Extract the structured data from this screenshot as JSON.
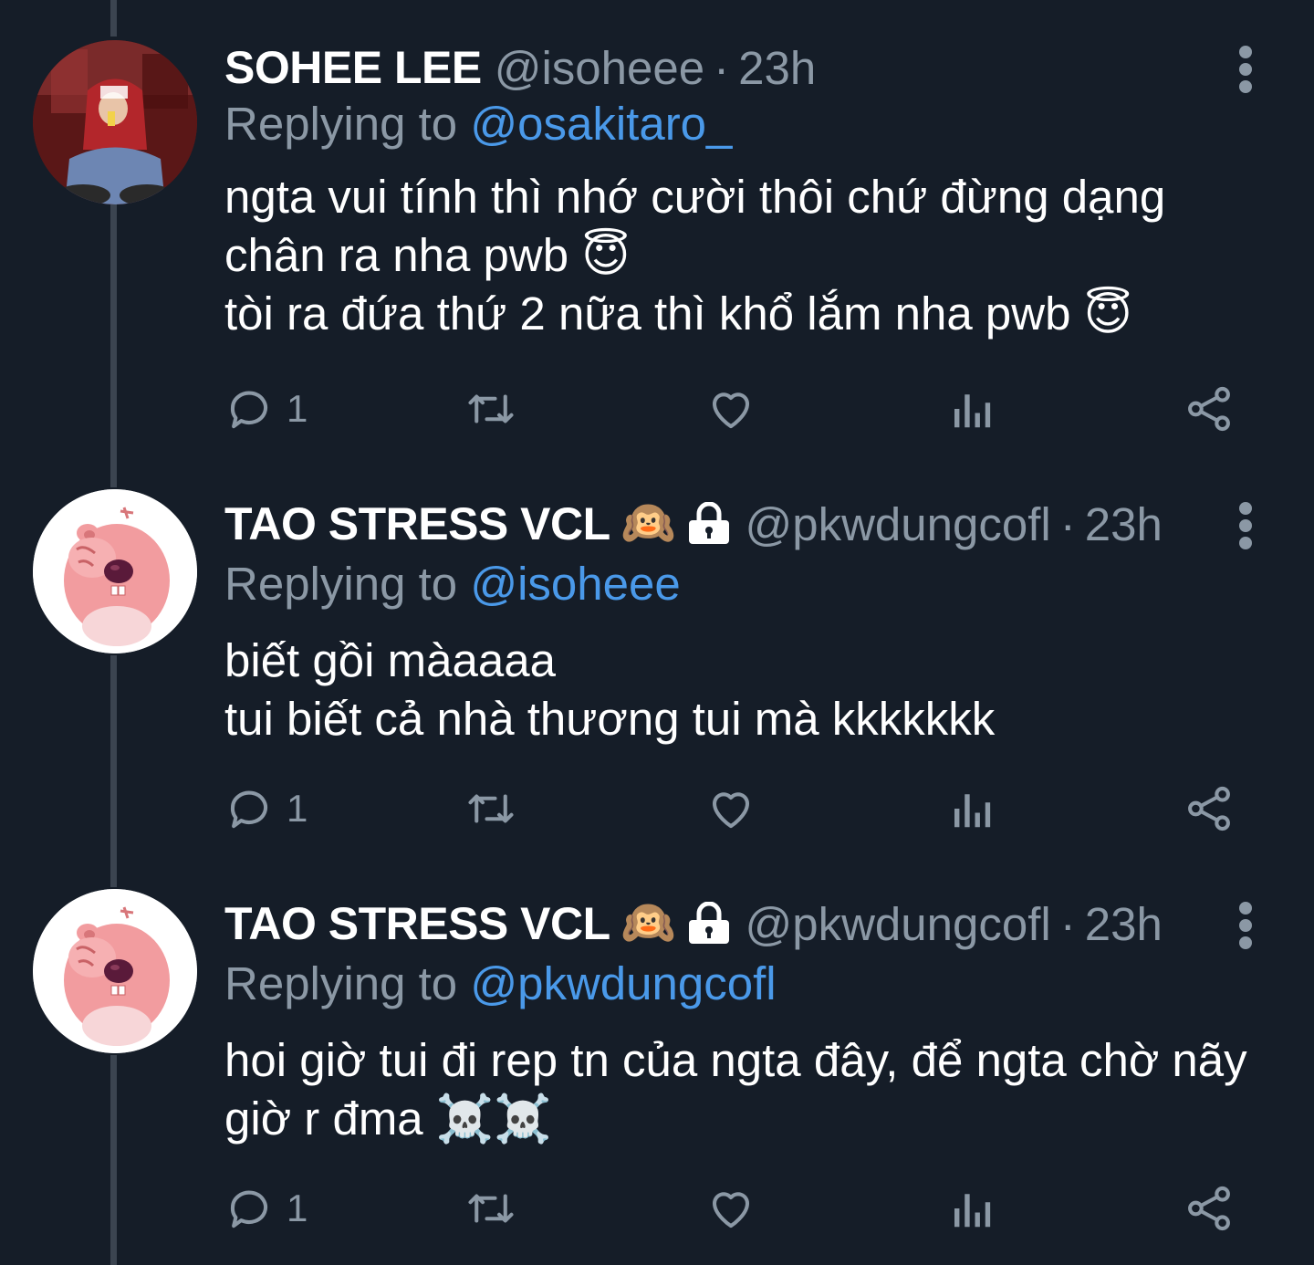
{
  "tweets": [
    {
      "display_name": "SOHEE LEE",
      "handle": "@isoheee",
      "separator": "·",
      "time": "23h",
      "replying_prefix": "Replying to",
      "replying_to": "@osakitaro_",
      "text": "ngta vui tính thì nhớ cười thôi chứ đừng dạng chân ra nha pwb 😇\ntòi ra đứa thứ 2 nữa thì khổ lắm nha pwb 😇",
      "reply_count": "1",
      "name_emoji": "",
      "locked": false
    },
    {
      "display_name": "TAO STRESS VCL",
      "handle": "@pkwdungcofl",
      "separator": "·",
      "time": "23h",
      "replying_prefix": "Replying to",
      "replying_to": "@isoheee",
      "text": "biết gồi màaaaa\ntui biết cả nhà thương tui mà kkkkkkk",
      "reply_count": "1",
      "name_emoji": "🙉",
      "locked": true
    },
    {
      "display_name": "TAO STRESS VCL",
      "handle": "@pkwdungcofl",
      "separator": "·",
      "time": "23h",
      "replying_prefix": "Replying to",
      "replying_to": "@pkwdungcofl",
      "text": "hoi giờ tui đi rep tn của ngta đây, để ngta chờ nãy giờ r đma ☠️☠️",
      "reply_count": "1",
      "name_emoji": "🙉",
      "locked": true
    }
  ],
  "icons": [
    "reply-icon",
    "retweet-icon",
    "like-icon",
    "analytics-icon",
    "share-icon",
    "more-icon",
    "lock-icon"
  ],
  "colors": {
    "background": "#151d28",
    "muted": "#8b98a5",
    "link": "#4a99e9",
    "thread_line": "#3b4450"
  }
}
